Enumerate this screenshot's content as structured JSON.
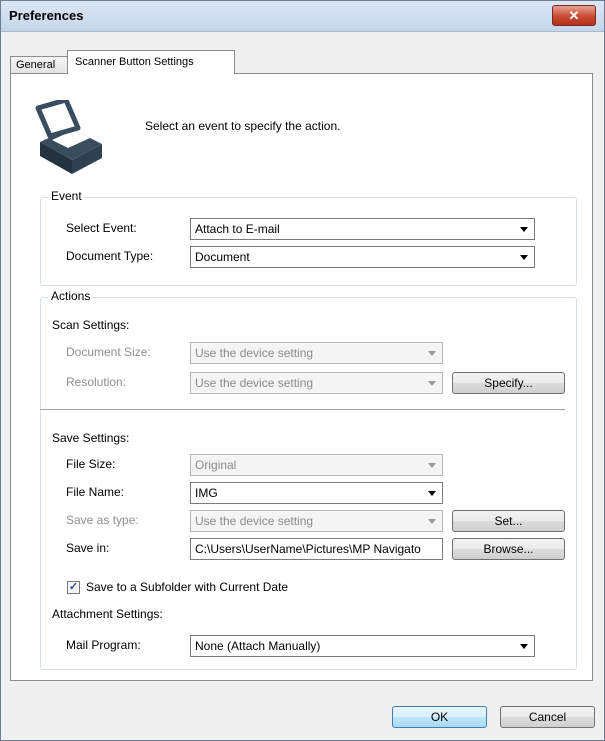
{
  "window": {
    "title": "Preferences",
    "close_label": "✕"
  },
  "tabs": [
    {
      "label": "General",
      "active": false
    },
    {
      "label": "Scanner Button Settings",
      "active": true
    }
  ],
  "header": {
    "instruction": "Select an event to specify the action.",
    "icon": "scanner-icon"
  },
  "event": {
    "group_label": "Event",
    "select_event_label": "Select Event:",
    "select_event_value": "Attach to E-mail",
    "document_type_label": "Document Type:",
    "document_type_value": "Document"
  },
  "actions": {
    "group_label": "Actions",
    "scan_settings_label": "Scan Settings:",
    "document_size_label": "Document Size:",
    "document_size_value": "Use the device setting",
    "resolution_label": "Resolution:",
    "resolution_value": "Use the device setting",
    "specify_button": "Specify...",
    "save_settings_label": "Save Settings:",
    "file_size_label": "File Size:",
    "file_size_value": "Original",
    "file_name_label": "File Name:",
    "file_name_value": "IMG",
    "save_as_type_label": "Save as type:",
    "save_as_type_value": "Use the device setting",
    "set_button": "Set...",
    "save_in_label": "Save in:",
    "save_in_value": "C:\\Users\\UserName\\Pictures\\MP Navigato",
    "browse_button": "Browse...",
    "subfolder_checkbox_label": "Save to a Subfolder with Current Date",
    "subfolder_checked": true,
    "attachment_settings_label": "Attachment Settings:",
    "mail_program_label": "Mail Program:",
    "mail_program_value": "None (Attach Manually)"
  },
  "footer": {
    "ok_button": "OK",
    "cancel_button": "Cancel"
  }
}
